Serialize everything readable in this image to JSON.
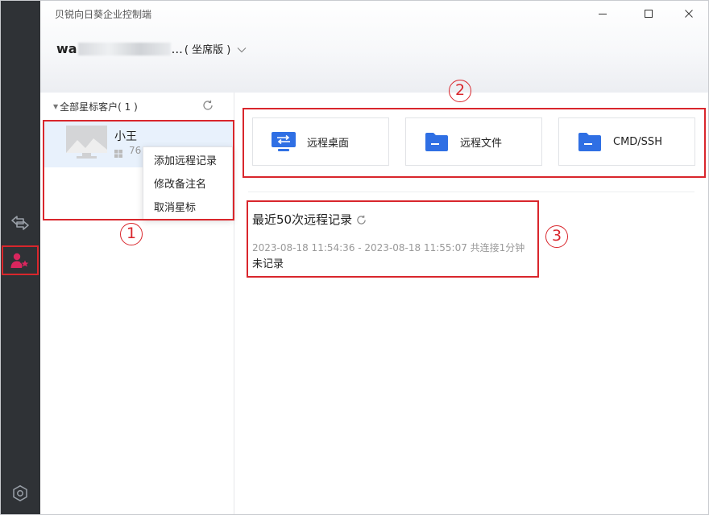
{
  "window": {
    "title": "贝锐向日葵企业控制端",
    "controls": [
      "minimize-icon",
      "maximize-icon",
      "close-icon"
    ]
  },
  "account": {
    "user_prefix": "wa",
    "user_suffix": "...",
    "edition": "( 坐席版 )"
  },
  "sidebar": {
    "icons": [
      "switch-arrows-icon",
      "starred-contacts-icon",
      "settings-icon"
    ],
    "active_color": "#d9265e"
  },
  "client_list": {
    "group_label": "全部星标客户( 1 )",
    "clients": [
      {
        "name": "小王",
        "id_partial": "76"
      }
    ]
  },
  "context_menu": {
    "items": [
      "添加远程记录",
      "修改备注名",
      "取消星标"
    ]
  },
  "actions": [
    {
      "label": "远程桌面",
      "icon": "remote-desktop-icon"
    },
    {
      "label": "远程文件",
      "icon": "folder-icon"
    },
    {
      "label": "CMD/SSH",
      "icon": "folder-icon"
    }
  ],
  "recent": {
    "title": "最近50次远程记录",
    "entry_time": "2023-08-18 11:54:36 - 2023-08-18 11:55:07 共连接1分钟",
    "entry_note": "未记录"
  },
  "annotations": [
    "1",
    "2",
    "3"
  ],
  "colors": {
    "rail": "#2f3236",
    "accent_blue": "#2f6fe4",
    "annotation_red": "#d9262c",
    "selected_row": "#e8f1fc"
  }
}
